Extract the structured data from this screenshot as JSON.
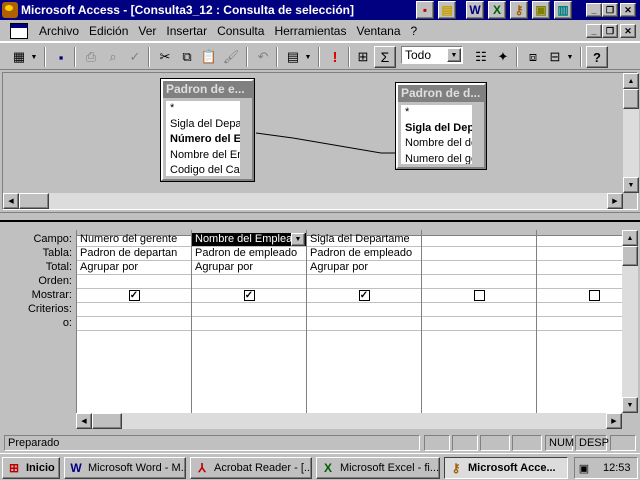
{
  "window": {
    "title": "Microsoft Access - [Consulta3_12 : Consulta de selección]"
  },
  "menu": [
    "Archivo",
    "Edición",
    "Ver",
    "Insertar",
    "Consulta",
    "Herramientas",
    "Ventana",
    "?"
  ],
  "toolbar": {
    "totals_symbol": "Σ",
    "top_values": "Todo",
    "run_symbol": "!",
    "help_symbol": "?"
  },
  "tables": [
    {
      "title": "Padron de e...",
      "fields": [
        {
          "name": "*",
          "bold": false
        },
        {
          "name": "Sigla del Departar",
          "bold": false
        },
        {
          "name": "Número del Emple",
          "bold": true
        },
        {
          "name": "Nombre del Emple",
          "bold": false
        },
        {
          "name": "Codigo del Cargo",
          "bold": false
        }
      ]
    },
    {
      "title": "Padron de d...",
      "fields": [
        {
          "name": "*",
          "bold": false
        },
        {
          "name": "Sigla del Departar",
          "bold": true
        },
        {
          "name": "Nombre del depar",
          "bold": false
        },
        {
          "name": "Numero del gerer",
          "bold": false
        }
      ]
    }
  ],
  "grid": {
    "row_labels": [
      "Campo:",
      "Tabla:",
      "Total:",
      "Orden:",
      "Mostrar:",
      "Criterios:",
      "o:"
    ],
    "columns": [
      {
        "campo": "Numero del gerente",
        "tabla": "Padron de departan",
        "total": "Agrupar por",
        "orden": "",
        "mostrar": true,
        "active": false
      },
      {
        "campo": "Nombre del Emplea",
        "tabla": "Padron de empleado",
        "total": "Agrupar por",
        "orden": "",
        "mostrar": true,
        "active": true
      },
      {
        "campo": "Sigla del Departame",
        "tabla": "Padron de empleado",
        "total": "Agrupar por",
        "orden": "",
        "mostrar": true,
        "active": false
      },
      {
        "campo": "",
        "tabla": "",
        "total": "",
        "orden": "",
        "mostrar": false,
        "active": false
      },
      {
        "campo": "",
        "tabla": "",
        "total": "",
        "orden": "",
        "mostrar": false,
        "active": false
      }
    ]
  },
  "status": {
    "text": "Preparado",
    "num": "NUM",
    "desp": "DESP"
  },
  "taskbar": {
    "start": "Inicio",
    "tasks": [
      {
        "label": "Microsoft Word - M...",
        "icon": "word-icon",
        "pressed": false
      },
      {
        "label": "Acrobat Reader - [...",
        "icon": "acrobat-icon",
        "pressed": false
      },
      {
        "label": "Microsoft Excel - fi...",
        "icon": "excel-icon",
        "pressed": false
      },
      {
        "label": "Microsoft Acce...",
        "icon": "access-key-icon",
        "pressed": true
      }
    ],
    "clock": "12:53"
  },
  "colors": {
    "titlebar": "#000080",
    "face": "#c0c0c0",
    "table_header": "#808080"
  }
}
